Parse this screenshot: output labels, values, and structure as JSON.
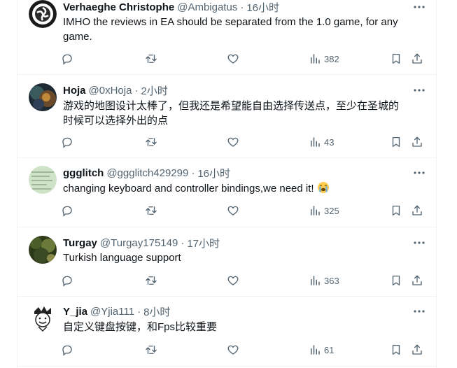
{
  "posts": [
    {
      "name": "Verhaeghe Christophe",
      "handle": "@Ambigatus",
      "time": "16小时",
      "text": "IMHO the reviews in EA should be separated from the 1.0 game, for any game.",
      "views": "382"
    },
    {
      "name": "Hoja",
      "handle": "@0xHoja",
      "time": "2小时",
      "text": "游戏的地图设计太棒了，但我还是希望能自由选择传送点，至少在圣城的时候可以选择外出的点",
      "views": "43"
    },
    {
      "name": "ggglitch",
      "handle": "@ggglitch429299",
      "time": "16小时",
      "text": "changing keyboard and controller bindings,we need it!",
      "emoji": "loudly-crying-face",
      "views": "325"
    },
    {
      "name": "Turgay",
      "handle": "@Turgay175149",
      "time": "17小时",
      "text": "Turkish language support",
      "views": "363"
    },
    {
      "name": "Y_jia",
      "handle": "@Yjia111",
      "time": "8小时",
      "text": "自定义键盘按键，和Fps比较重要",
      "views": "61"
    }
  ],
  "separator": "·",
  "colors": {
    "text": "#0f1419",
    "muted": "#536471",
    "border": "#eff3f4"
  }
}
